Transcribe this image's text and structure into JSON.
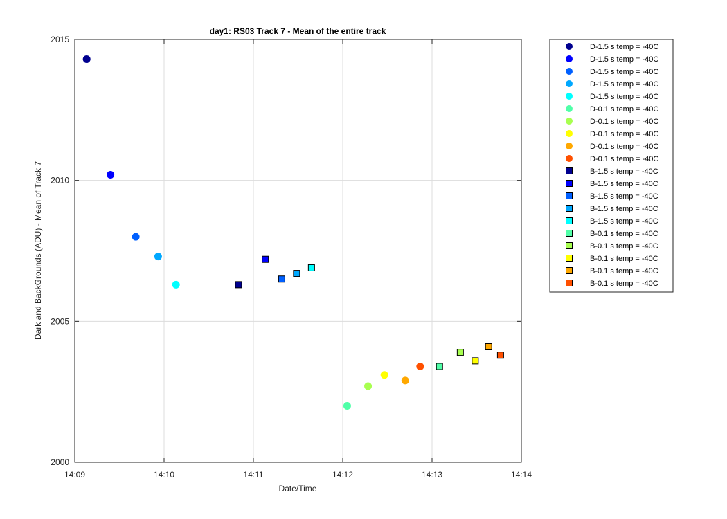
{
  "chart_data": {
    "type": "scatter",
    "title": "day1: RS03  Track 7 - Mean of the entire track",
    "xlabel": "Date/Time",
    "ylabel": "Dark and BackGrounds (ADU) - Mean of Track 7",
    "xlim": [
      "14:09",
      "14:14"
    ],
    "ylim": [
      2000,
      2015
    ],
    "x_ticks": [
      "14:09",
      "14:10",
      "14:11",
      "14:12",
      "14:13",
      "14:14"
    ],
    "y_ticks": [
      2000,
      2005,
      2010,
      2015
    ],
    "grid": true,
    "legend_position": "outside-top-right",
    "series": [
      {
        "name": "D-1.5 s temp = -40C",
        "marker": "circle",
        "color": "#00008f",
        "x": "14:09:08",
        "y": 2014.3
      },
      {
        "name": "D-1.5 s temp = -40C",
        "marker": "circle",
        "color": "#0000ff",
        "x": "14:09:24",
        "y": 2010.2
      },
      {
        "name": "D-1.5 s temp = -40C",
        "marker": "circle",
        "color": "#0060ff",
        "x": "14:09:41",
        "y": 2008.0
      },
      {
        "name": "D-1.5 s temp = -40C",
        "marker": "circle",
        "color": "#00a8ff",
        "x": "14:09:56",
        "y": 2007.3
      },
      {
        "name": "D-1.5 s temp = -40C",
        "marker": "circle",
        "color": "#00ffff",
        "x": "14:10:08",
        "y": 2006.3
      },
      {
        "name": "D-0.1 s temp = -40C",
        "marker": "circle",
        "color": "#50ffa8",
        "x": "14:12:03",
        "y": 2002.0
      },
      {
        "name": "D-0.1 s temp = -40C",
        "marker": "circle",
        "color": "#a8ff50",
        "x": "14:12:17",
        "y": 2002.7
      },
      {
        "name": "D-0.1 s temp = -40C",
        "marker": "circle",
        "color": "#ffff00",
        "x": "14:12:28",
        "y": 2003.1
      },
      {
        "name": "D-0.1 s temp = -40C",
        "marker": "circle",
        "color": "#ffa800",
        "x": "14:12:42",
        "y": 2002.9
      },
      {
        "name": "D-0.1 s temp = -40C",
        "marker": "circle",
        "color": "#ff5000",
        "x": "14:12:52",
        "y": 2003.4
      },
      {
        "name": "B-1.5 s temp = -40C",
        "marker": "square",
        "color": "#00008f",
        "x": "14:10:50",
        "y": 2006.3
      },
      {
        "name": "B-1.5 s temp = -40C",
        "marker": "square",
        "color": "#0000ff",
        "x": "14:11:08",
        "y": 2007.2
      },
      {
        "name": "B-1.5 s temp = -40C",
        "marker": "square",
        "color": "#0060ff",
        "x": "14:11:19",
        "y": 2006.5
      },
      {
        "name": "B-1.5 s temp = -40C",
        "marker": "square",
        "color": "#00a8ff",
        "x": "14:11:29",
        "y": 2006.7
      },
      {
        "name": "B-1.5 s temp = -40C",
        "marker": "square",
        "color": "#00ffff",
        "x": "14:11:39",
        "y": 2006.9
      },
      {
        "name": "B-0.1 s temp = -40C",
        "marker": "square",
        "color": "#50ffa8",
        "x": "14:13:05",
        "y": 2003.4
      },
      {
        "name": "B-0.1 s temp = -40C",
        "marker": "square",
        "color": "#a8ff50",
        "x": "14:13:19",
        "y": 2003.9
      },
      {
        "name": "B-0.1 s temp = -40C",
        "marker": "square",
        "color": "#ffff00",
        "x": "14:13:29",
        "y": 2003.6
      },
      {
        "name": "B-0.1 s temp = -40C",
        "marker": "square",
        "color": "#ffa800",
        "x": "14:13:38",
        "y": 2004.1
      },
      {
        "name": "B-0.1 s temp = -40C",
        "marker": "square",
        "color": "#ff5000",
        "x": "14:13:46",
        "y": 2003.8
      }
    ]
  }
}
